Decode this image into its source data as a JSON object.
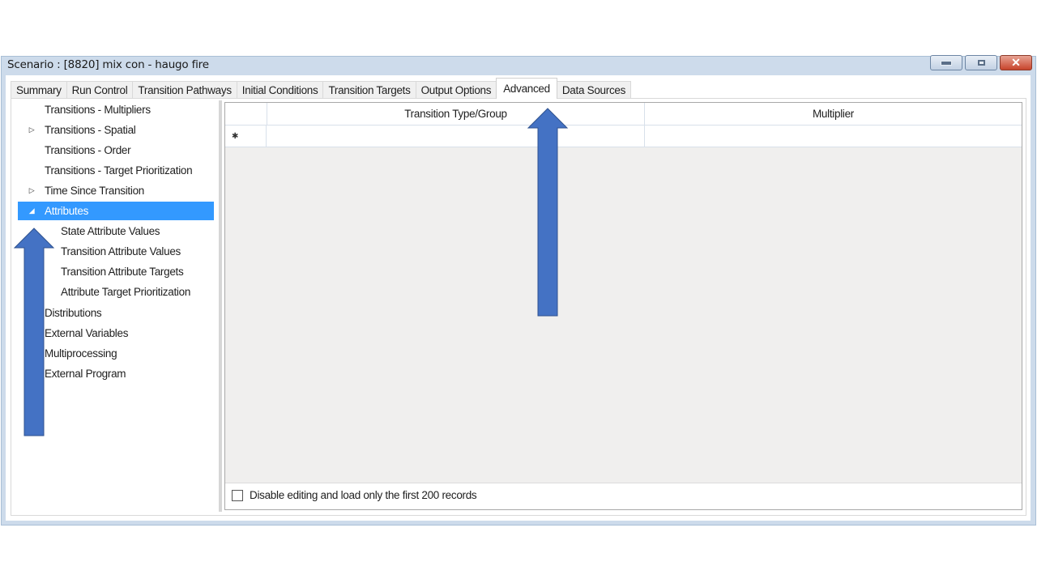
{
  "window": {
    "title": "Scenario : [8820] mix con - haugo fire",
    "controls": {
      "minimize": "minimize",
      "maximize": "maximize",
      "close": "✕"
    }
  },
  "tabs": [
    {
      "label": "Summary",
      "active": false
    },
    {
      "label": "Run Control",
      "active": false
    },
    {
      "label": "Transition Pathways",
      "active": false
    },
    {
      "label": "Initial Conditions",
      "active": false
    },
    {
      "label": "Transition Targets",
      "active": false
    },
    {
      "label": "Output Options",
      "active": false
    },
    {
      "label": "Advanced",
      "active": true
    },
    {
      "label": "Data Sources",
      "active": false
    }
  ],
  "tree": {
    "items": [
      {
        "label": "Transitions - Multipliers",
        "level": 1,
        "expander": "none",
        "selected": false
      },
      {
        "label": "Transitions - Spatial",
        "level": 1,
        "expander": "collapsed",
        "selected": false
      },
      {
        "label": "Transitions - Order",
        "level": 1,
        "expander": "none",
        "selected": false
      },
      {
        "label": "Transitions - Target Prioritization",
        "level": 1,
        "expander": "none",
        "selected": false
      },
      {
        "label": "Time Since Transition",
        "level": 1,
        "expander": "collapsed",
        "selected": false
      },
      {
        "label": "Attributes",
        "level": 1,
        "expander": "expanded",
        "selected": true
      },
      {
        "label": "State Attribute Values",
        "level": 2,
        "expander": "none",
        "selected": false
      },
      {
        "label": "Transition Attribute Values",
        "level": 2,
        "expander": "none",
        "selected": false
      },
      {
        "label": "Transition Attribute Targets",
        "level": 2,
        "expander": "none",
        "selected": false
      },
      {
        "label": "Attribute Target Prioritization",
        "level": 2,
        "expander": "none",
        "selected": false
      },
      {
        "label": "Distributions",
        "level": 0,
        "expander": "none",
        "selected": false
      },
      {
        "label": "External Variables",
        "level": 0,
        "expander": "none",
        "selected": false
      },
      {
        "label": "Multiprocessing",
        "level": 0,
        "expander": "none",
        "selected": false
      },
      {
        "label": "External Program",
        "level": 0,
        "expander": "none",
        "selected": false
      }
    ],
    "expander_glyphs": {
      "collapsed": "▷",
      "expanded": "◢"
    }
  },
  "grid": {
    "columns": [
      "Transition Type/Group",
      "Multiplier"
    ],
    "new_row_marker": "✱",
    "rows": []
  },
  "footer": {
    "checkbox_label": "Disable editing and load only the first 200 records",
    "checked": false
  },
  "annotations": {
    "arrow_color": "#4472c4",
    "arrows": [
      {
        "points_to": "Attributes tree item"
      },
      {
        "points_to": "Advanced tab"
      }
    ]
  }
}
